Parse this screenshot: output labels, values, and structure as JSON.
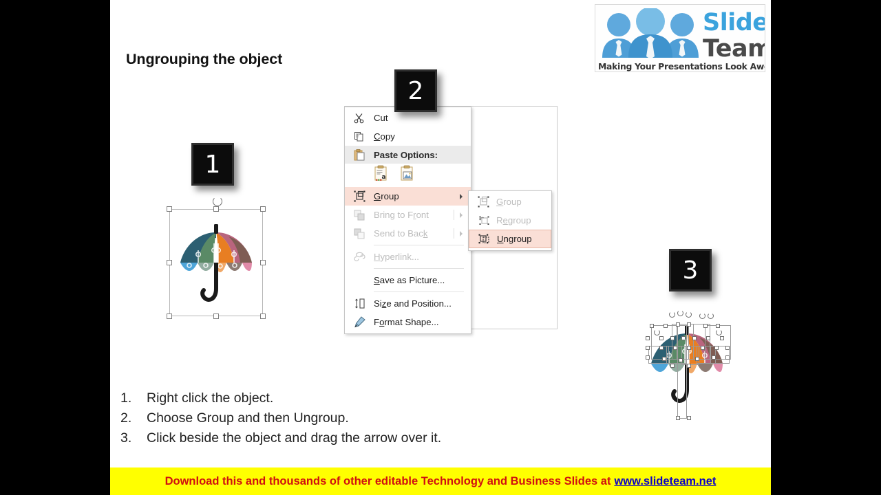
{
  "slide": {
    "title": "Ungrouping the object"
  },
  "logo": {
    "word1": "Slide",
    "word2": "Team",
    "tagline": "Making Your Presentations Look Awesome",
    "brand_blue": "#3ba3dd",
    "brand_gray": "#4a4a4a"
  },
  "badges": [
    {
      "label": "1"
    },
    {
      "label": "2"
    },
    {
      "label": "3"
    }
  ],
  "context_menu": {
    "items": [
      {
        "label": "Cut",
        "icon": "scissors-icon",
        "state": "normal",
        "accel": "t",
        "submenu": false
      },
      {
        "label": "Copy",
        "icon": "copy-icon",
        "state": "normal",
        "accel": "C",
        "submenu": false
      },
      {
        "label": "Paste Options:",
        "icon": "paste-icon",
        "state": "header",
        "submenu": false
      },
      {
        "label": "Group",
        "icon": "group-icon",
        "state": "highlighted",
        "accel": "G",
        "submenu": true
      },
      {
        "label": "Bring to Front",
        "icon": "bring-to-front-icon",
        "state": "disabled",
        "accel": "r",
        "submenu": true
      },
      {
        "label": "Send to Back",
        "icon": "send-to-back-icon",
        "state": "disabled",
        "accel": "k",
        "submenu": true
      },
      {
        "label": "Hyperlink...",
        "icon": "hyperlink-icon",
        "state": "disabled",
        "accel": "H",
        "submenu": false
      },
      {
        "label": "Save as Picture...",
        "icon": "none",
        "state": "normal",
        "accel": "S",
        "submenu": false
      },
      {
        "label": "Size and Position...",
        "icon": "size-position-icon",
        "state": "normal",
        "accel": "z",
        "submenu": false
      },
      {
        "label": "Format Shape...",
        "icon": "format-shape-icon",
        "state": "normal",
        "accel": "o",
        "submenu": false
      }
    ],
    "paste_options": [
      {
        "name": "paste-keep-text-icon"
      },
      {
        "name": "paste-picture-icon"
      }
    ],
    "highlight_color": "#fadfd6"
  },
  "submenu": {
    "items": [
      {
        "label": "Group",
        "icon": "group-icon",
        "state": "disabled",
        "accel": "G"
      },
      {
        "label": "Regroup",
        "icon": "regroup-icon",
        "state": "disabled",
        "accel": "e"
      },
      {
        "label": "Ungroup",
        "icon": "ungroup-icon",
        "state": "highlighted",
        "accel": "U"
      }
    ]
  },
  "instructions": [
    {
      "num": "1.",
      "text": "Right click the object."
    },
    {
      "num": "2.",
      "text": "Choose Group and then Ungroup."
    },
    {
      "num": "3.",
      "text": "Click beside the object and drag the arrow over it."
    }
  ],
  "footer": {
    "text": "Download this and thousands of other editable Technology and Business Slides at",
    "link": "www.slideteam.net",
    "bg": "#ffff00",
    "text_color": "#d01010",
    "link_color": "#0b00c8"
  },
  "umbrella": {
    "colors": [
      "#2c5f72",
      "#5a8a66",
      "#e87e22",
      "#b9657e",
      "#7a5c50",
      "#4ea5d9",
      "#92ada0",
      "#f0a868",
      "#8c7a72",
      "#e08aa8"
    ],
    "handle_color": "#1a1a1a"
  }
}
